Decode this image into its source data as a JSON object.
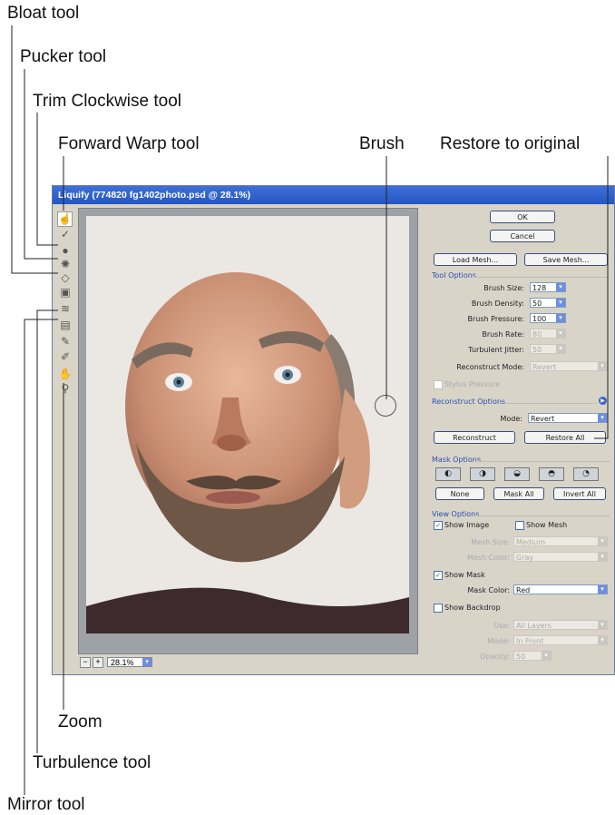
{
  "callouts": {
    "bloat": "Bloat tool",
    "pucker": "Pucker tool",
    "trim_clockwise": "Trim Clockwise tool",
    "forward_warp": "Forward Warp tool",
    "brush": "Brush",
    "restore_original": "Restore to original",
    "zoom": "Zoom",
    "turbulence": "Turbulence tool",
    "mirror": "Mirror tool"
  },
  "window": {
    "title": "Liquify (774820 fg1402photo.psd @ 28.1%)"
  },
  "statusbar": {
    "zoom_value": "28.1%"
  },
  "panel": {
    "ok_label": "OK",
    "cancel_label": "Cancel",
    "load_mesh_label": "Load Mesh...",
    "save_mesh_label": "Save Mesh...",
    "tool_options": {
      "title": "Tool Options",
      "brush_size_label": "Brush Size:",
      "brush_size_value": "128",
      "brush_density_label": "Brush Density:",
      "brush_density_value": "50",
      "brush_pressure_label": "Brush Pressure:",
      "brush_pressure_value": "100",
      "brush_rate_label": "Brush Rate:",
      "brush_rate_value": "80",
      "turbulent_jitter_label": "Turbulent Jitter:",
      "turbulent_jitter_value": "50",
      "reconstruct_mode_label": "Reconstruct Mode:",
      "reconstruct_mode_value": "Revert",
      "stylus_pressure_label": "Stylus Pressure"
    },
    "reconstruct_options": {
      "title": "Reconstruct Options",
      "mode_label": "Mode:",
      "mode_value": "Revert",
      "reconstruct_label": "Reconstruct",
      "restore_all_label": "Restore All"
    },
    "mask_options": {
      "title": "Mask Options",
      "none_label": "None",
      "mask_all_label": "Mask All",
      "invert_all_label": "Invert All"
    },
    "view_options": {
      "title": "View Options",
      "show_image_label": "Show Image",
      "show_mesh_label": "Show Mesh",
      "mesh_size_label": "Mesh Size:",
      "mesh_size_value": "Medium",
      "mesh_color_label": "Mesh Color:",
      "mesh_color_value": "Gray",
      "show_mask_label": "Show Mask",
      "mask_color_label": "Mask Color:",
      "mask_color_value": "Red",
      "show_backdrop_label": "Show Backdrop",
      "use_label": "Use:",
      "use_value": "All Layers",
      "mode_label": "Mode:",
      "mode_value": "In Front",
      "opacity_label": "Opacity:",
      "opacity_value": "50"
    }
  },
  "colors": {
    "titlebar": "#2456c6",
    "dialog_bg": "#d8d4c8",
    "accent": "#2f4fb0"
  }
}
